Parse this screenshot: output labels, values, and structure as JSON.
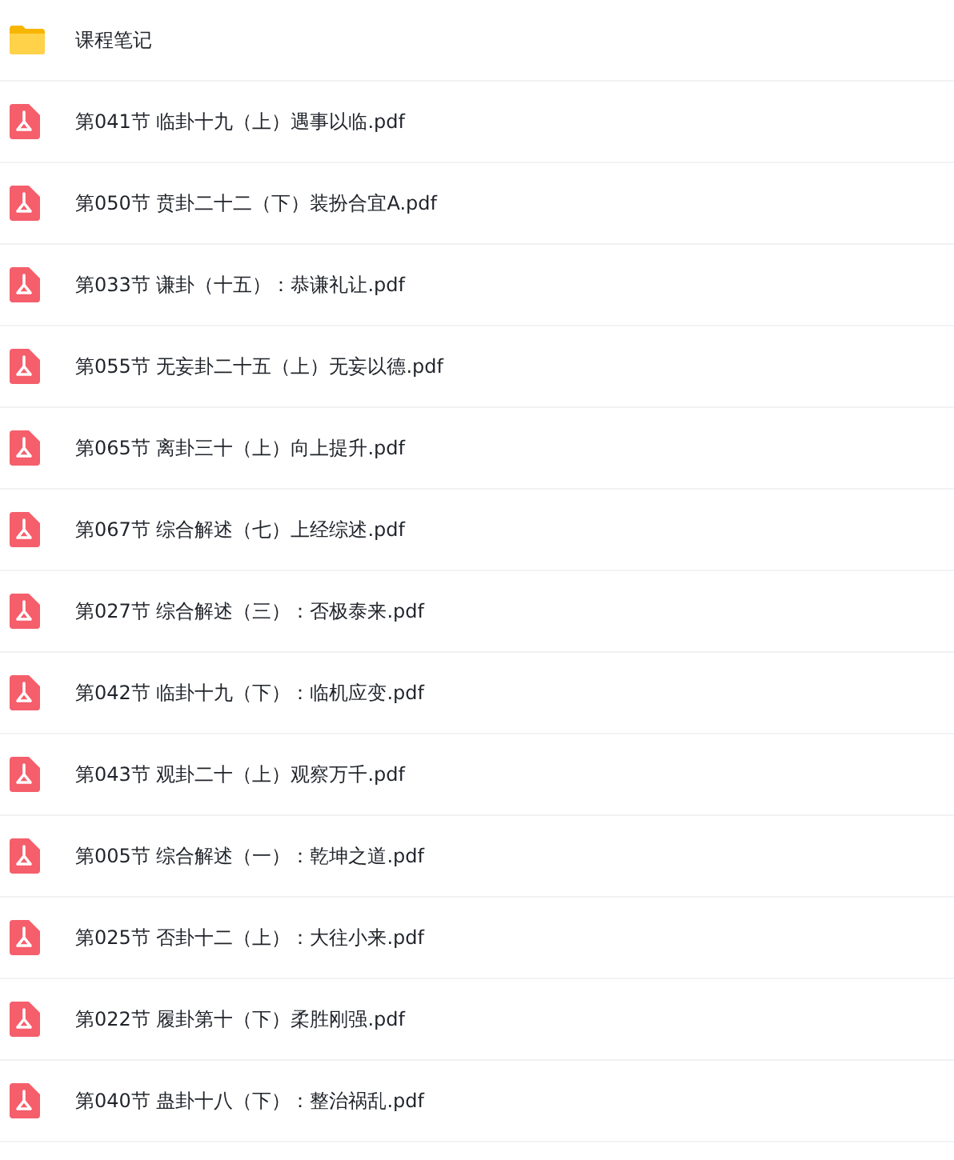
{
  "files": [
    {
      "kind": "folder",
      "name": "课程笔记"
    },
    {
      "kind": "pdf",
      "name": "第041节 临卦十九（上）遇事以临.pdf"
    },
    {
      "kind": "pdf",
      "name": "第050节 贲卦二十二（下）装扮合宜A.pdf"
    },
    {
      "kind": "pdf",
      "name": "第033节 谦卦（十五）：恭谦礼让.pdf"
    },
    {
      "kind": "pdf",
      "name": "第055节 无妄卦二十五（上）无妄以德.pdf"
    },
    {
      "kind": "pdf",
      "name": "第065节 离卦三十（上）向上提升.pdf"
    },
    {
      "kind": "pdf",
      "name": "第067节 综合解述（七）上经综述.pdf"
    },
    {
      "kind": "pdf",
      "name": "第027节 综合解述（三）：否极泰来.pdf"
    },
    {
      "kind": "pdf",
      "name": "第042节 临卦十九（下）：临机应变.pdf"
    },
    {
      "kind": "pdf",
      "name": "第043节 观卦二十（上）观察万千.pdf"
    },
    {
      "kind": "pdf",
      "name": "第005节 综合解述（一）：乾坤之道.pdf"
    },
    {
      "kind": "pdf",
      "name": "第025节 否卦十二（上）：大往小来.pdf"
    },
    {
      "kind": "pdf",
      "name": "第022节 履卦第十（下）柔胜刚强.pdf"
    },
    {
      "kind": "pdf",
      "name": "第040节 蛊卦十八（下）：整治祸乱.pdf"
    }
  ]
}
